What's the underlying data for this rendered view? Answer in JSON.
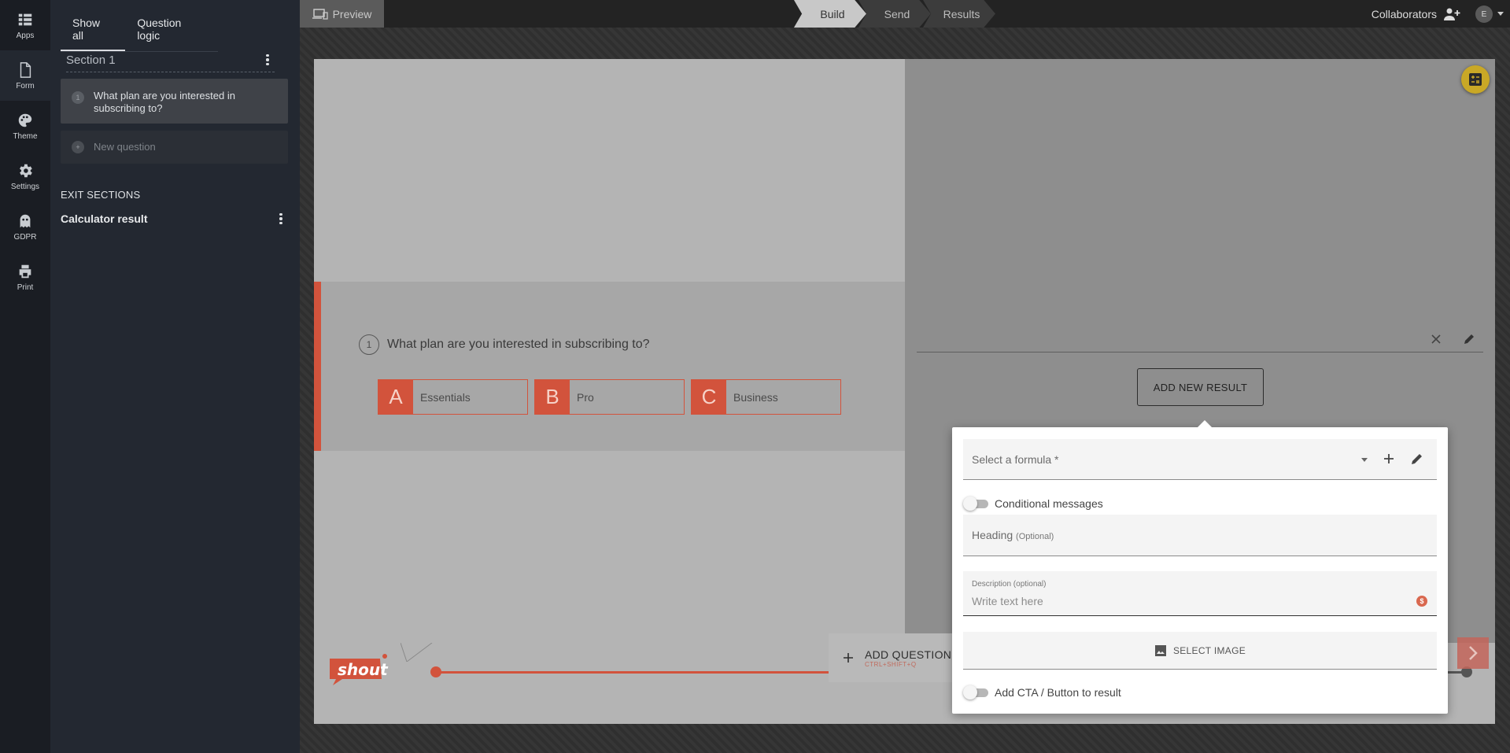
{
  "rail": {
    "items": [
      {
        "label": "Apps",
        "icon": "apps-grid-icon"
      },
      {
        "label": "Form",
        "icon": "form-document-icon"
      },
      {
        "label": "Theme",
        "icon": "palette-icon"
      },
      {
        "label": "Settings",
        "icon": "gear-icon"
      },
      {
        "label": "GDPR",
        "icon": "ghost-icon"
      },
      {
        "label": "Print",
        "icon": "printer-icon"
      }
    ]
  },
  "panel": {
    "tabs": [
      "Show all",
      "Question logic"
    ],
    "section_title": "Section 1",
    "questions": [
      {
        "number": "1",
        "text": "What plan are you interested in subscribing to?"
      }
    ],
    "new_question": "New question",
    "exit_sections_label": "EXIT SECTIONS",
    "exit_item": "Calculator result"
  },
  "topbar": {
    "preview": "Preview",
    "steps": [
      "Build",
      "Send",
      "Results"
    ],
    "collaborators": "Collaborators",
    "avatar_initial": "E"
  },
  "canvas": {
    "question_number": "1",
    "question_title": "What plan are you interested in subscribing to?",
    "choices": [
      {
        "letter": "A",
        "label": "Essentials"
      },
      {
        "letter": "B",
        "label": "Pro"
      },
      {
        "letter": "C",
        "label": "Business"
      }
    ],
    "add_new_result": "ADD NEW RESULT",
    "add_question": "ADD QUESTION",
    "add_question_shortcut": "CTRL+SHIFT+Q",
    "logo_text": "shout"
  },
  "popover": {
    "formula_placeholder": "Select a formula *",
    "conditional_messages": "Conditional messages",
    "heading_label": "Heading",
    "heading_optional": "(Optional)",
    "description_label": "Description (optional)",
    "description_placeholder": "Write text here",
    "select_image": "SELECT IMAGE",
    "add_cta": "Add CTA / Button to result"
  },
  "colors": {
    "accent": "#d2533c",
    "fab": "#c9a826",
    "rail_bg": "#1a1d23",
    "panel_bg": "#232831"
  }
}
